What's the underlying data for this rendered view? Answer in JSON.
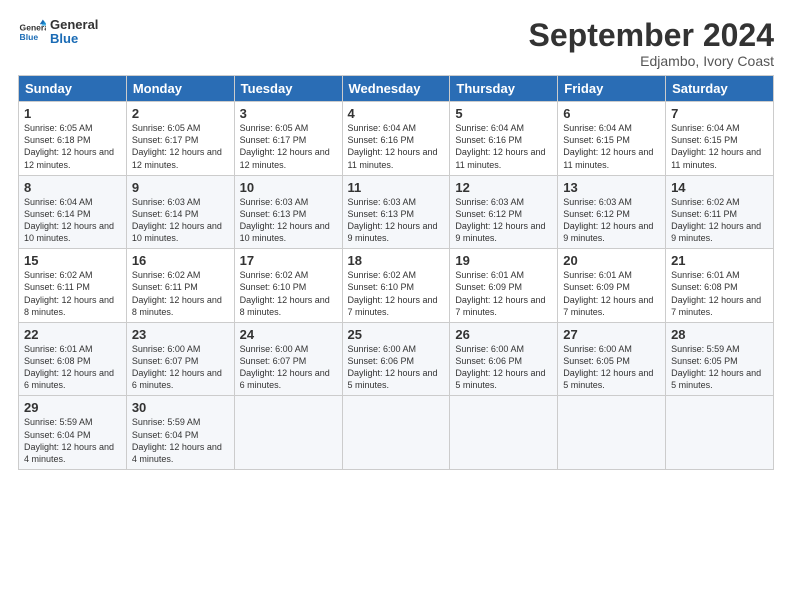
{
  "logo": {
    "line1": "General",
    "line2": "Blue"
  },
  "title": "September 2024",
  "subtitle": "Edjambo, Ivory Coast",
  "days_header": [
    "Sunday",
    "Monday",
    "Tuesday",
    "Wednesday",
    "Thursday",
    "Friday",
    "Saturday"
  ],
  "weeks": [
    [
      {
        "num": "1",
        "rise": "6:05 AM",
        "set": "6:18 PM",
        "daylight": "12 hours and 12 minutes."
      },
      {
        "num": "2",
        "rise": "6:05 AM",
        "set": "6:17 PM",
        "daylight": "12 hours and 12 minutes."
      },
      {
        "num": "3",
        "rise": "6:05 AM",
        "set": "6:17 PM",
        "daylight": "12 hours and 12 minutes."
      },
      {
        "num": "4",
        "rise": "6:04 AM",
        "set": "6:16 PM",
        "daylight": "12 hours and 11 minutes."
      },
      {
        "num": "5",
        "rise": "6:04 AM",
        "set": "6:16 PM",
        "daylight": "12 hours and 11 minutes."
      },
      {
        "num": "6",
        "rise": "6:04 AM",
        "set": "6:15 PM",
        "daylight": "12 hours and 11 minutes."
      },
      {
        "num": "7",
        "rise": "6:04 AM",
        "set": "6:15 PM",
        "daylight": "12 hours and 11 minutes."
      }
    ],
    [
      {
        "num": "8",
        "rise": "6:04 AM",
        "set": "6:14 PM",
        "daylight": "12 hours and 10 minutes."
      },
      {
        "num": "9",
        "rise": "6:03 AM",
        "set": "6:14 PM",
        "daylight": "12 hours and 10 minutes."
      },
      {
        "num": "10",
        "rise": "6:03 AM",
        "set": "6:13 PM",
        "daylight": "12 hours and 10 minutes."
      },
      {
        "num": "11",
        "rise": "6:03 AM",
        "set": "6:13 PM",
        "daylight": "12 hours and 9 minutes."
      },
      {
        "num": "12",
        "rise": "6:03 AM",
        "set": "6:12 PM",
        "daylight": "12 hours and 9 minutes."
      },
      {
        "num": "13",
        "rise": "6:03 AM",
        "set": "6:12 PM",
        "daylight": "12 hours and 9 minutes."
      },
      {
        "num": "14",
        "rise": "6:02 AM",
        "set": "6:11 PM",
        "daylight": "12 hours and 9 minutes."
      }
    ],
    [
      {
        "num": "15",
        "rise": "6:02 AM",
        "set": "6:11 PM",
        "daylight": "12 hours and 8 minutes."
      },
      {
        "num": "16",
        "rise": "6:02 AM",
        "set": "6:11 PM",
        "daylight": "12 hours and 8 minutes."
      },
      {
        "num": "17",
        "rise": "6:02 AM",
        "set": "6:10 PM",
        "daylight": "12 hours and 8 minutes."
      },
      {
        "num": "18",
        "rise": "6:02 AM",
        "set": "6:10 PM",
        "daylight": "12 hours and 7 minutes."
      },
      {
        "num": "19",
        "rise": "6:01 AM",
        "set": "6:09 PM",
        "daylight": "12 hours and 7 minutes."
      },
      {
        "num": "20",
        "rise": "6:01 AM",
        "set": "6:09 PM",
        "daylight": "12 hours and 7 minutes."
      },
      {
        "num": "21",
        "rise": "6:01 AM",
        "set": "6:08 PM",
        "daylight": "12 hours and 7 minutes."
      }
    ],
    [
      {
        "num": "22",
        "rise": "6:01 AM",
        "set": "6:08 PM",
        "daylight": "12 hours and 6 minutes."
      },
      {
        "num": "23",
        "rise": "6:00 AM",
        "set": "6:07 PM",
        "daylight": "12 hours and 6 minutes."
      },
      {
        "num": "24",
        "rise": "6:00 AM",
        "set": "6:07 PM",
        "daylight": "12 hours and 6 minutes."
      },
      {
        "num": "25",
        "rise": "6:00 AM",
        "set": "6:06 PM",
        "daylight": "12 hours and 5 minutes."
      },
      {
        "num": "26",
        "rise": "6:00 AM",
        "set": "6:06 PM",
        "daylight": "12 hours and 5 minutes."
      },
      {
        "num": "27",
        "rise": "6:00 AM",
        "set": "6:05 PM",
        "daylight": "12 hours and 5 minutes."
      },
      {
        "num": "28",
        "rise": "5:59 AM",
        "set": "6:05 PM",
        "daylight": "12 hours and 5 minutes."
      }
    ],
    [
      {
        "num": "29",
        "rise": "5:59 AM",
        "set": "6:04 PM",
        "daylight": "12 hours and 4 minutes."
      },
      {
        "num": "30",
        "rise": "5:59 AM",
        "set": "6:04 PM",
        "daylight": "12 hours and 4 minutes."
      },
      null,
      null,
      null,
      null,
      null
    ]
  ]
}
